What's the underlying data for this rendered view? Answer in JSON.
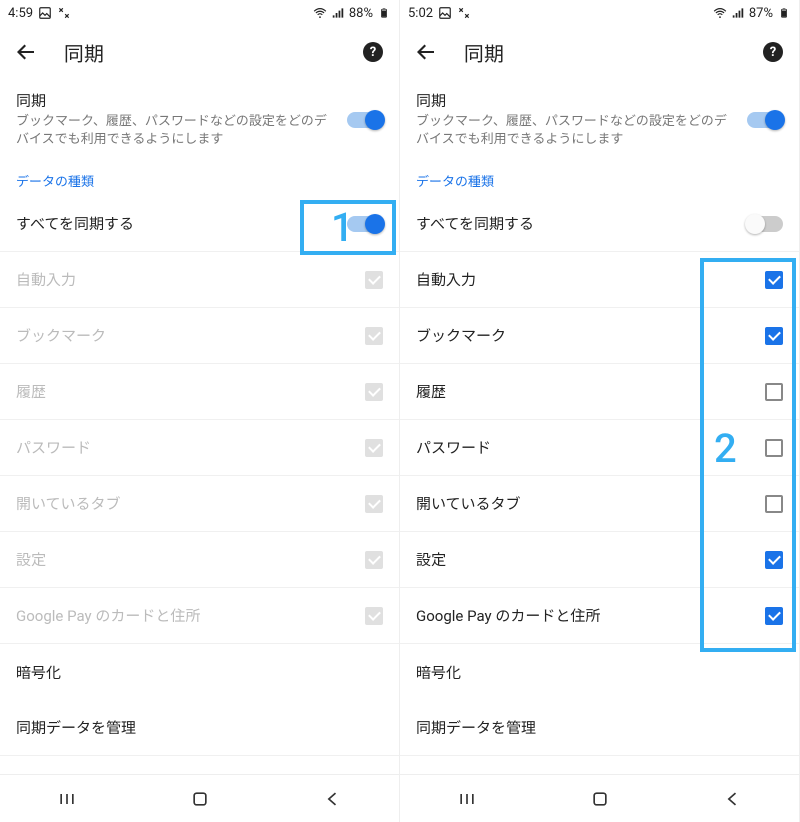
{
  "left": {
    "status": {
      "time": "4:59",
      "battery": "88%"
    },
    "topbar": {
      "title": "同期"
    },
    "sync": {
      "title": "同期",
      "desc": "ブックマーク、履歴、パスワードなどの設定をどのデバイスでも利用できるようにします"
    },
    "dataTypesLabel": "データの種類",
    "syncAllLabel": "すべてを同期する",
    "items": [
      {
        "label": "自動入力"
      },
      {
        "label": "ブックマーク"
      },
      {
        "label": "履歴"
      },
      {
        "label": "パスワード"
      },
      {
        "label": "開いているタブ"
      },
      {
        "label": "設定"
      },
      {
        "label": "Google Pay のカードと住所"
      }
    ],
    "encryptionLabel": "暗号化",
    "manageLabel": "同期データを管理"
  },
  "right": {
    "status": {
      "time": "5:02",
      "battery": "87%"
    },
    "topbar": {
      "title": "同期"
    },
    "sync": {
      "title": "同期",
      "desc": "ブックマーク、履歴、パスワードなどの設定をどのデバイスでも利用できるようにします"
    },
    "dataTypesLabel": "データの種類",
    "syncAllLabel": "すべてを同期する",
    "items": [
      {
        "label": "自動入力"
      },
      {
        "label": "ブックマーク"
      },
      {
        "label": "履歴"
      },
      {
        "label": "パスワード"
      },
      {
        "label": "開いているタブ"
      },
      {
        "label": "設定"
      },
      {
        "label": "Google Pay のカードと住所"
      }
    ],
    "encryptionLabel": "暗号化",
    "manageLabel": "同期データを管理"
  },
  "annot": {
    "one": "1",
    "two": "2"
  }
}
